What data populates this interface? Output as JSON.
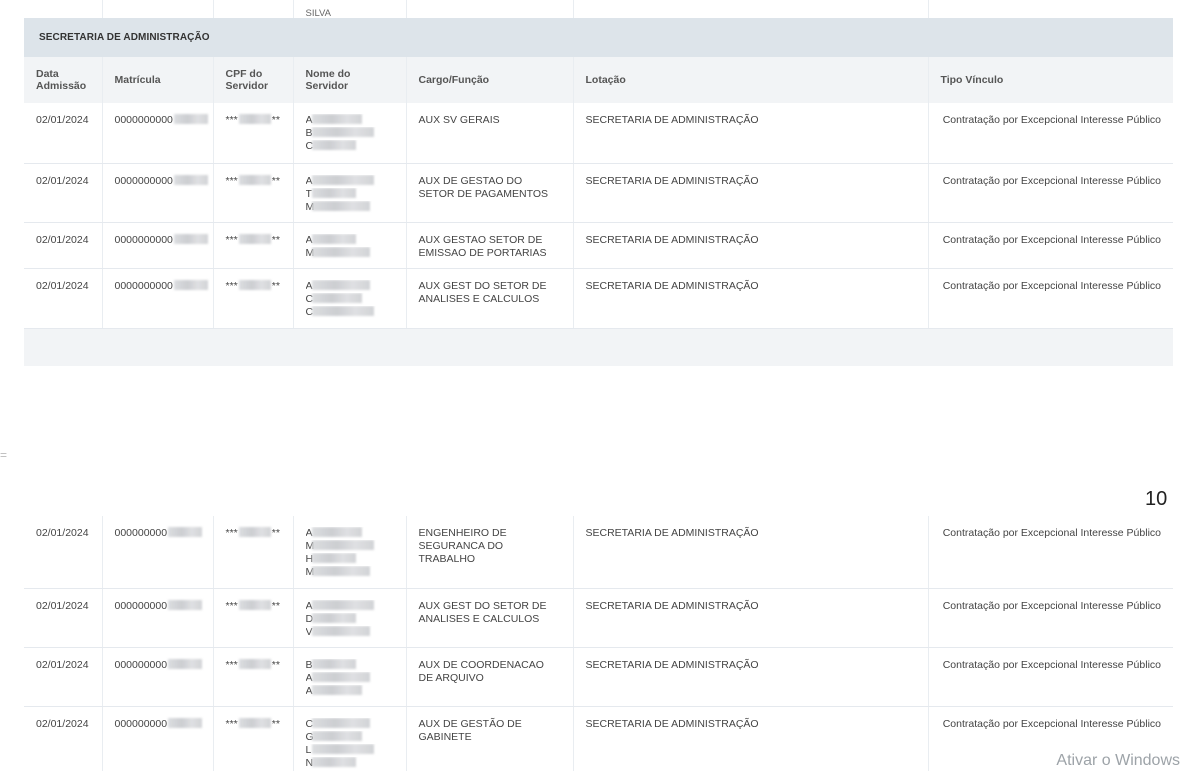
{
  "page_number": "10",
  "watermark": "Ativar o Windows",
  "side_mark": "=",
  "prev_row_name_tail": "SILVA",
  "section_title": "SECRETARIA DE ADMINISTRAÇÃO",
  "columns": {
    "date": "Data Admissão",
    "matricula": "Matrícula",
    "cpf": "CPF do Servidor",
    "nome": "Nome do Servidor",
    "cargo": "Cargo/Função",
    "lotacao": "Lotação",
    "tipo": "Tipo Vínculo"
  },
  "rows_top": [
    {
      "date": "02/01/2024",
      "mat": "0000000000",
      "cpf": "***",
      "cpf_end": "**",
      "name_initials": [
        "A",
        "B",
        "C"
      ],
      "cargo": "AUX SV GERAIS",
      "lotacao": "SECRETARIA DE ADMINISTRAÇÃO",
      "tipo": "Contratação por Excepcional Interesse Público"
    },
    {
      "date": "02/01/2024",
      "mat": "0000000000",
      "cpf": "***",
      "cpf_end": "**",
      "name_initials": [
        "A",
        "T",
        "M"
      ],
      "cargo": "AUX DE GESTAO DO SETOR DE PAGAMENTOS",
      "lotacao": "SECRETARIA DE ADMINISTRAÇÃO",
      "tipo": "Contratação por Excepcional Interesse Público"
    },
    {
      "date": "02/01/2024",
      "mat": "0000000000",
      "cpf": "***",
      "cpf_end": "**",
      "name_initials": [
        "A",
        "M"
      ],
      "cargo": "AUX GESTAO SETOR DE EMISSAO DE PORTARIAS",
      "lotacao": "SECRETARIA DE ADMINISTRAÇÃO",
      "tipo": "Contratação por Excepcional Interesse Público"
    },
    {
      "date": "02/01/2024",
      "mat": "0000000000",
      "cpf": "***",
      "cpf_end": "**",
      "name_initials": [
        "A",
        "C",
        "C"
      ],
      "cargo": "AUX GEST DO SETOR DE ANALISES E CALCULOS",
      "lotacao": "SECRETARIA DE ADMINISTRAÇÃO",
      "tipo": "Contratação por Excepcional Interesse Público"
    }
  ],
  "rows_bottom": [
    {
      "date": "02/01/2024",
      "mat": "000000000",
      "cpf": "***",
      "cpf_end": "**",
      "name_initials": [
        "A",
        "M",
        "H",
        "M"
      ],
      "cargo": "ENGENHEIRO DE SEGURANCA DO TRABALHO",
      "lotacao": "SECRETARIA DE ADMINISTRAÇÃO",
      "tipo": "Contratação por Excepcional Interesse Público"
    },
    {
      "date": "02/01/2024",
      "mat": "000000000",
      "cpf": "***",
      "cpf_end": "**",
      "name_initials": [
        "A",
        "D",
        "V"
      ],
      "cargo": "AUX GEST DO SETOR DE ANALISES E CALCULOS",
      "lotacao": "SECRETARIA DE ADMINISTRAÇÃO",
      "tipo": "Contratação por Excepcional Interesse Público"
    },
    {
      "date": "02/01/2024",
      "mat": "000000000",
      "cpf": "***",
      "cpf_end": "**",
      "name_initials": [
        "B",
        "A",
        "A"
      ],
      "cargo": "AUX DE COORDENACAO DE ARQUIVO",
      "lotacao": "SECRETARIA DE ADMINISTRAÇÃO",
      "tipo": "Contratação por Excepcional Interesse Público"
    },
    {
      "date": "02/01/2024",
      "mat": "000000000",
      "cpf": "***",
      "cpf_end": "**",
      "name_initials": [
        "C",
        "G",
        "L",
        "N"
      ],
      "cargo": "AUX DE GESTÃO DE GABINETE",
      "lotacao": "SECRETARIA DE ADMINISTRAÇÃO",
      "tipo": "Contratação por Excepcional Interesse Público"
    }
  ]
}
